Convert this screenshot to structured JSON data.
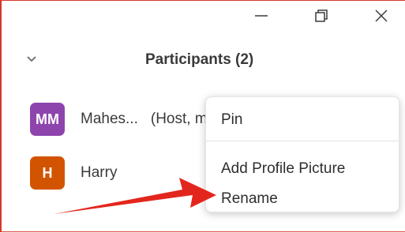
{
  "window_controls": {
    "minimize_icon": "minimize-icon",
    "restore_icon": "restore-icon",
    "close_icon": "close-icon"
  },
  "header": {
    "title": "Participants (2)",
    "collapse_icon": "chevron-down-icon"
  },
  "participants": [
    {
      "initials": "MM",
      "name": "Mahes...",
      "role": "(Host, me)",
      "avatar_color": "#8e44ad"
    },
    {
      "initials": "H",
      "name": "Harry",
      "avatar_color": "#d35400"
    }
  ],
  "context_menu": {
    "items": [
      "Pin",
      "Add Profile Picture",
      "Rename"
    ]
  },
  "annotation": {
    "arrow_color": "#e3261d",
    "arrow_target": "Rename"
  }
}
